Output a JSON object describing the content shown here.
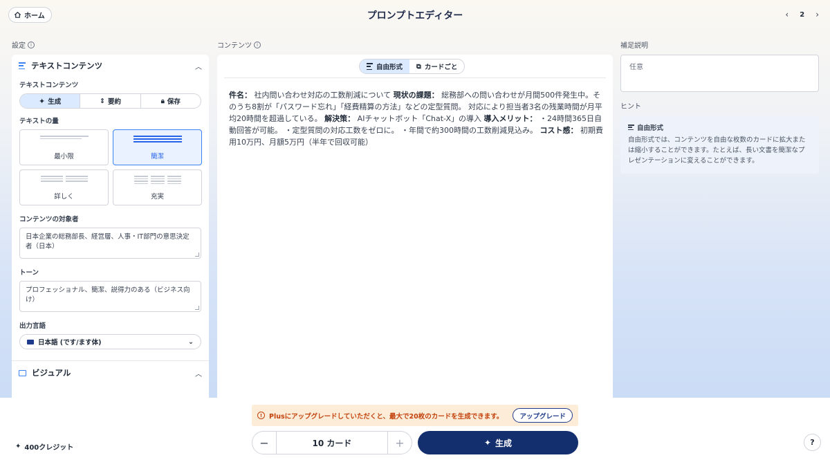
{
  "header": {
    "home_label": "ホーム",
    "title": "プロンプトエディター",
    "page_number": "2"
  },
  "settings": {
    "section_label": "設定",
    "text_panel": {
      "title": "テキストコンテンツ",
      "mode_label": "テキストコンテンツ",
      "modes": [
        "生成",
        "要約",
        "保存"
      ],
      "active_mode": "生成",
      "amount_label": "テキストの量",
      "amounts": [
        "最小限",
        "簡潔",
        "詳しく",
        "充実"
      ],
      "active_amount": "簡潔",
      "audience_label": "コンテンツの対象者",
      "audience_value": "日本企業の総務部長、経営層、人事・IT部門の意思決定者（日本）",
      "tone_label": "トーン",
      "tone_value": "プロフェッショナル、簡潔、説得力のある（ビジネス向け）",
      "language_label": "出力言語",
      "language_value": "日本語 (です/ます体)"
    },
    "visual_panel": {
      "title": "ビジュアル"
    }
  },
  "content": {
    "section_label": "コンテンツ",
    "tabs": [
      "自由形式",
      "カードごと"
    ],
    "active_tab": "自由形式",
    "segments": [
      {
        "bold": "件名：",
        "text": " 社内問い合わせ対応の工数削減について "
      },
      {
        "bold": "現状の課題：",
        "text": " 総務部への問い合わせが月間500件発生中。そのうち8割が「パスワード忘れ」「経費精算の方法」などの定型質問。 対応により担当者3名の残業時間が月平均20時間を超過している。 "
      },
      {
        "bold": "解決策：",
        "text": " AIチャットボット「Chat-X」の導入 "
      },
      {
        "bold": "導入メリット：",
        "text": " ・24時間365日自動回答が可能。 ・定型質問の対応工数をゼロに。 ・年間で約300時間の工数削減見込み。 "
      },
      {
        "bold": "コスト感：",
        "text": " 初期費用10万円、月額5万円（半年で回収可能）"
      }
    ]
  },
  "notes": {
    "section_label": "補足説明",
    "placeholder": "任意",
    "hint_label": "ヒント",
    "hint_title": "自由形式",
    "hint_body": "自由形式では、コンテンツを自由な枚数のカードに拡大または縮小することができます。たとえば、長い文書を簡潔なプレゼンテーションに変えることができます。"
  },
  "footer": {
    "upgrade_message": "Plusにアップグレードしていただくと、最大で20枚のカードを生成できます。",
    "upgrade_button": "アップグレード",
    "card_count": "10 カード",
    "generate_label": "生成",
    "credits": "400クレジット",
    "help_label": "?"
  },
  "colors": {
    "accent": "#3b82f6",
    "primary_button": "#142f6e",
    "warning_bg": "#fdecd8",
    "warning_text": "#c2410c"
  }
}
